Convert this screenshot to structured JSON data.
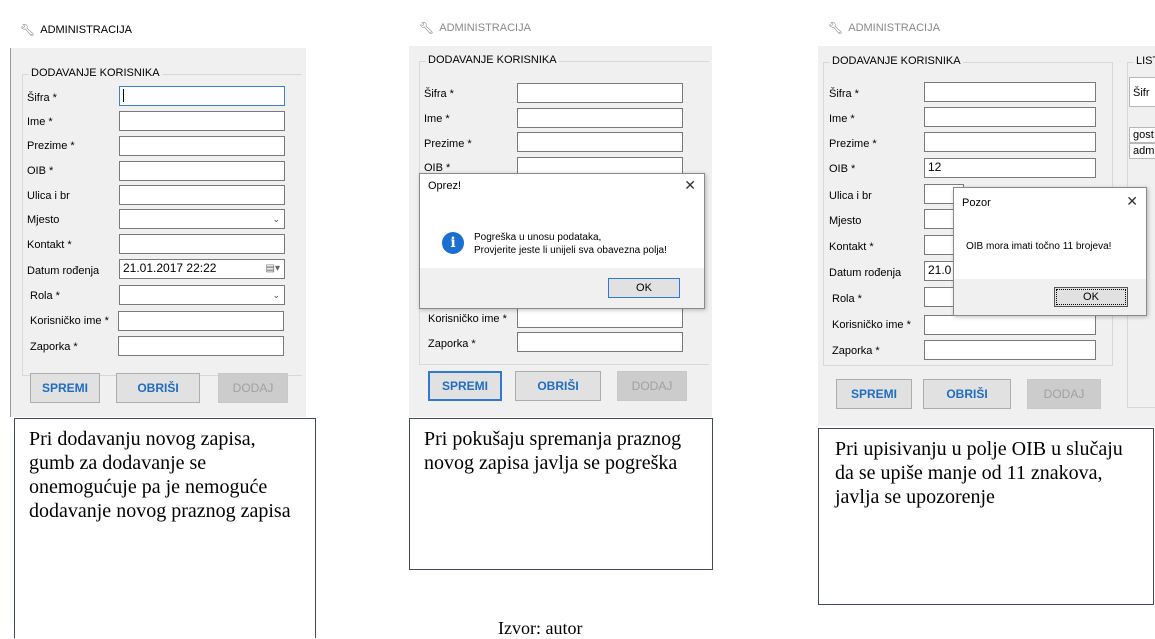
{
  "window_title": "ADMINISTRACIJA",
  "group_title": "DODAVANJE KORISNIKA",
  "fields": {
    "sifra": "Šifra *",
    "ime": "Ime *",
    "prezime": "Prezime *",
    "oib": "OIB *",
    "ulica": "Ulica i br",
    "mjesto": "Mjesto",
    "kontakt": "Kontakt *",
    "datum": "Datum rođenja",
    "rola": "Rola *",
    "korisnicko_ime": "Korisničko ime *",
    "zaporka": "Zaporka *"
  },
  "buttons": {
    "spremi": "SPREMI",
    "obrisi": "OBRIŠI",
    "dodaj": "DODAJ"
  },
  "panel1": {
    "datum_value": "21.01.2017 22:22",
    "caption": "Pri dodavanju novog zapisa, gumb za dodavanje se onemogućuje pa je nemoguće dodavanje novog praznog zapisa"
  },
  "panel2": {
    "dialog_title": "Oprez!",
    "dialog_line1": "Pogreška u unosu podataka,",
    "dialog_line2": "Provjerite jeste li unijeli sva obavezna polja!",
    "dialog_ok": "OK",
    "caption": "Pri pokušaju spremanja praznog novog zapisa javlja se pogreška"
  },
  "panel3": {
    "oib_value": "12",
    "datum_value": "21.0",
    "list_title": "LIST",
    "list_header": "Šifr",
    "list_rows": [
      "gost",
      "adm"
    ],
    "dialog_title": "Pozor",
    "dialog_msg": "OIB mora imati točno 11 brojeva!",
    "dialog_ok": "OK",
    "caption": "Pri upisivanju u polje OIB u slučaju da se upiše manje od 11 znakova, javlja se upozorenje"
  },
  "source_text": "Izvor: autor",
  "icons": {
    "title_icon": "wrench-icon",
    "dropdown": "chevron-down-icon",
    "calendar": "calendar-icon",
    "info": "info-icon",
    "close": "close-icon"
  }
}
